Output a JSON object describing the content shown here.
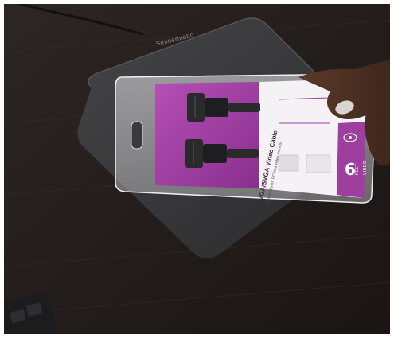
{
  "photo": {
    "pad_brand": "Sennermatic",
    "package": {
      "title": "VGA/SVGA Video Cable",
      "subtitle": "Connect your PC to a video monitor",
      "length_number": "6",
      "length_unit": "FEET",
      "side_label": "VIDEO"
    }
  },
  "colors": {
    "package_purple": "#9e3fa0",
    "package_white": "#f4f2f4",
    "desk": "#2a2422",
    "pad": "#3a3a3c"
  }
}
